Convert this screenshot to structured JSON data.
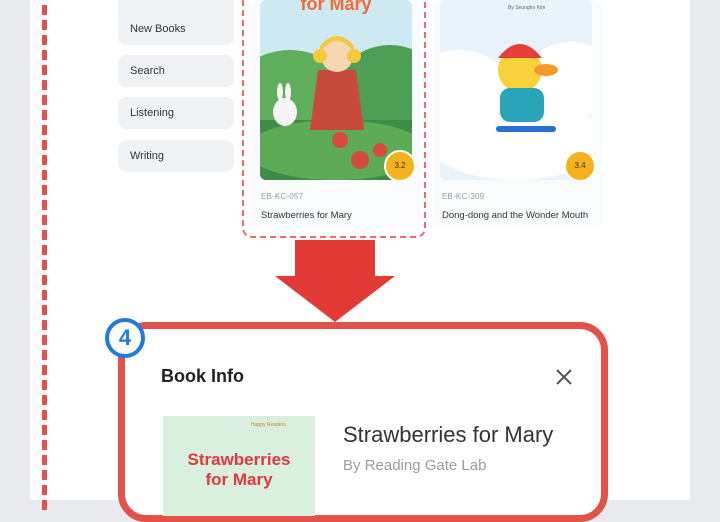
{
  "sidebar": {
    "items": [
      {
        "label": "New Books"
      },
      {
        "label": "Search"
      },
      {
        "label": "Listening"
      },
      {
        "label": "Writing"
      }
    ]
  },
  "books": [
    {
      "code": "EB-KC-057",
      "title": "Strawberries for Mary",
      "level": "3.2",
      "cover_text": "for Mary",
      "selected": true
    },
    {
      "code": "EB-KC-309",
      "title": "Dong-dong and the Wonder Mouth",
      "level": "3.4",
      "cover_text": "By Seungho Kim",
      "selected": false
    }
  ],
  "step_number": "4",
  "modal": {
    "title": "Book Info",
    "book_title": "Strawberries for Mary",
    "author": "By Reading Gate Lab",
    "cover_series": "Happy Readers",
    "cover_title_line1": "Strawberries",
    "cover_title_line2": "for Mary"
  },
  "colors": {
    "highlight": "#e0524a",
    "arrow": "#e23b36",
    "step_badge": "#1f7ae0",
    "level_badge": "#f5b21c"
  },
  "icons": {
    "close": "close-icon",
    "arrow": "arrow-down-icon"
  }
}
